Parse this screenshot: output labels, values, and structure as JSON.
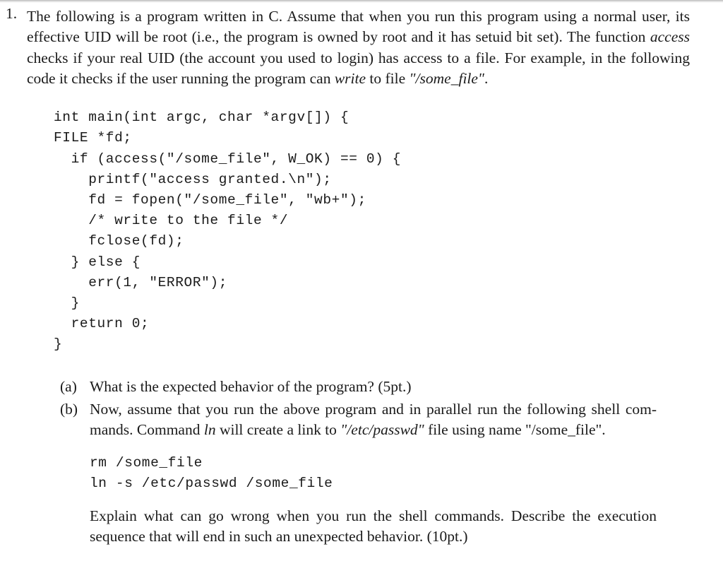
{
  "document": {
    "type": "exam-question",
    "background_color": "#ffffff",
    "text_color": "#1a1a1a"
  },
  "question": {
    "number": "1.",
    "intro": {
      "seg1": "The following is a program written in C. Assume that when you run this program using a normal user, its effective UID will be root (i.e., the program is owned by root and it has setuid bit set). The function ",
      "em1": "access",
      "seg2": " checks if your real UID (the account you used to login) has access to a file. For example, in the following code it checks if the user running the program can ",
      "em2": "write",
      "seg3": " to file ",
      "em3": "\"/some_file\"",
      "seg4": "."
    },
    "code": "int main(int argc, char *argv[]) {\nFILE *fd;\n  if (access(\"/some_file\", W_OK) == 0) {\n    printf(\"access granted.\\n\");\n    fd = fopen(\"/some_file\", \"wb+\");\n    /* write to the file */\n    fclose(fd);\n  } else {\n    err(1, \"ERROR\");\n  }\n  return 0;\n}",
    "parts": [
      {
        "label": "(a)",
        "text": "What is the expected behavior of the program? (5pt.)"
      },
      {
        "label": "(b)",
        "seg1": "Now, assume that you run the above program and in parallel run the following shell com-mands. Command ",
        "em1": "ln",
        "seg2": " will create a link to ",
        "em2": "\"/etc/passwd\"",
        "seg3": " file using name \"/some_file\".",
        "commands": "rm /some_file\nln -s /etc/passwd /some_file",
        "tail": "Explain what can go wrong when you run the shell commands. Describe the execution sequence that will end in such an unexpected behavior. (10pt.)"
      }
    ]
  }
}
